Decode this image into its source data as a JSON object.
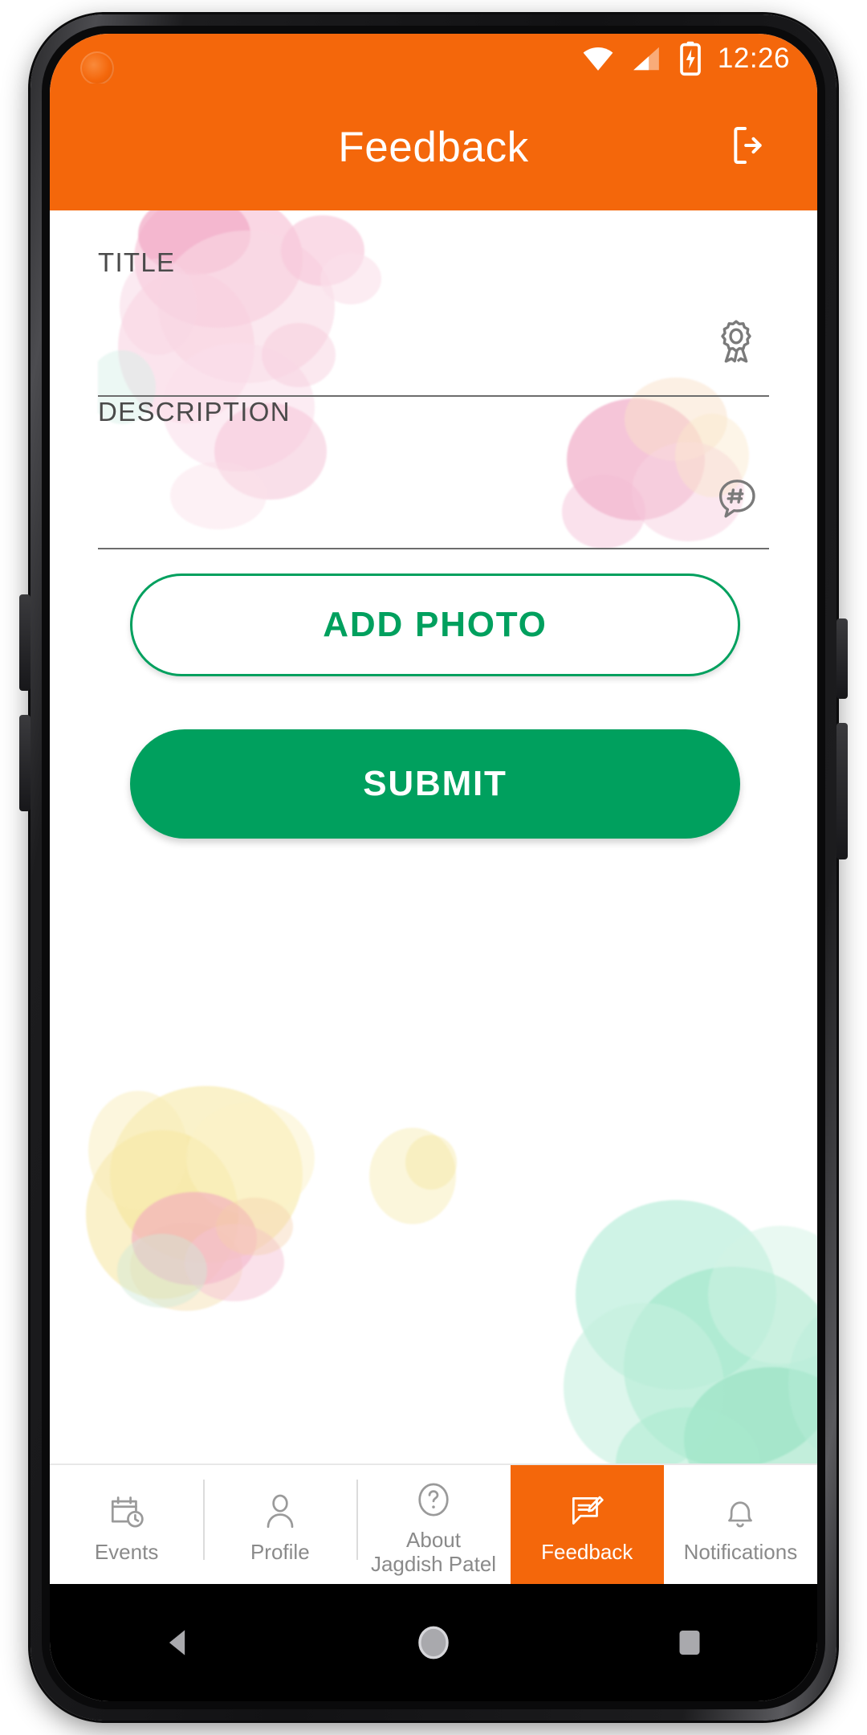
{
  "statusbar": {
    "time": "12:26",
    "icons": [
      "wifi-icon",
      "cellular-signal-icon",
      "battery-charging-icon"
    ]
  },
  "appbar": {
    "title": "Feedback",
    "logout_icon": "logout-icon",
    "background_color": "#F4670B"
  },
  "form": {
    "title_field": {
      "label": "TITLE",
      "value": "",
      "placeholder": "",
      "icon": "award-ribbon-icon"
    },
    "description_field": {
      "label": "DESCRIPTION",
      "value": "",
      "placeholder": "",
      "icon": "hashtag-chat-icon"
    },
    "add_photo_label": "ADD PHOTO",
    "submit_label": "SUBMIT",
    "accent_color": "#00A05E"
  },
  "bottom_nav": {
    "active_index": 3,
    "items": [
      {
        "label": "Events",
        "icon": "calendar-clock-icon"
      },
      {
        "label": "Profile",
        "icon": "person-icon"
      },
      {
        "label": "About\nJagdish Patel",
        "line1": "About",
        "line2": "Jagdish Patel",
        "icon": "question-circle-icon"
      },
      {
        "label": "Feedback",
        "icon": "feedback-edit-icon"
      },
      {
        "label": "Notifications",
        "icon": "bell-icon"
      }
    ]
  },
  "system_nav": {
    "back": "back-triangle-icon",
    "home": "home-circle-icon",
    "recents": "recents-square-icon"
  }
}
